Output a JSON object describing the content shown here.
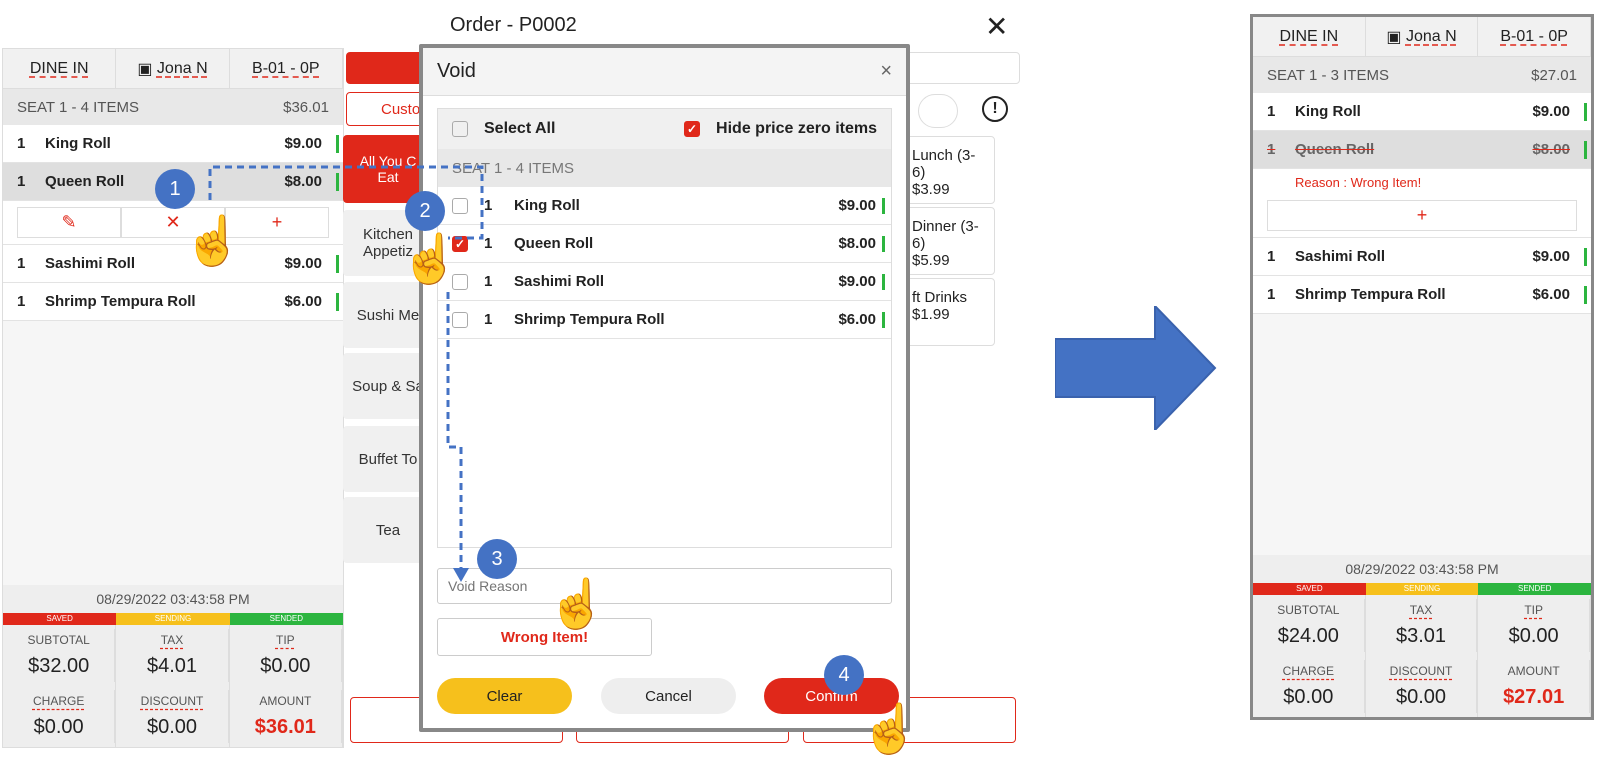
{
  "order_title": "Order - P0002",
  "header": {
    "type": "DINE IN",
    "server": "Jona N",
    "table": "B-01 -  0P"
  },
  "left": {
    "seat": "SEAT 1 - 4 ITEMS",
    "seat_total": "$36.01",
    "items": [
      {
        "qty": "1",
        "name": "King Roll",
        "price": "$9.00"
      },
      {
        "qty": "1",
        "name": "Queen Roll",
        "price": "$8.00"
      },
      {
        "qty": "1",
        "name": "Sashimi Roll",
        "price": "$9.00"
      },
      {
        "qty": "1",
        "name": "Shrimp Tempura Roll",
        "price": "$6.00"
      }
    ],
    "timestamp": "08/29/2022 03:43:58 PM",
    "status": [
      "SAVED",
      "SENDING",
      "SENDED"
    ],
    "subtotal_l": "SUBTOTAL",
    "subtotal": "$32.00",
    "tax_l": "TAX",
    "tax": "$4.01",
    "tip_l": "TIP",
    "tip": "$0.00",
    "charge_l": "CHARGE",
    "charge": "$0.00",
    "discount_l": "DISCOUNT",
    "discount": "$0.00",
    "amount_l": "AMOUNT",
    "amount": "$36.01"
  },
  "categories": [
    "All You Can Eat",
    "Kitchen Appetizer",
    "Sushi Menu",
    "Soup & Salad",
    "Buffet To",
    "Tea"
  ],
  "cat_partial": [
    "All You C\nEat",
    "Kitchen\nAppetiz",
    "Sushi Me",
    "Soup & Sa",
    "Buffet To",
    "Tea"
  ],
  "custom_label": "Custo",
  "menu_items": [
    {
      "name": "Lunch (3-6)",
      "price": "$3.99"
    },
    {
      "name": "Dinner (3-6)",
      "price": "$5.99"
    },
    {
      "name": "ft Drinks",
      "price": "$1.99"
    }
  ],
  "modal": {
    "title": "Void",
    "close": "×",
    "select_all": "Select All",
    "hide_zero": "Hide price zero items",
    "seat": "SEAT 1 - 4 ITEMS",
    "items": [
      {
        "qty": "1",
        "name": "King Roll",
        "price": "$9.00",
        "checked": false
      },
      {
        "qty": "1",
        "name": "Queen Roll",
        "price": "$8.00",
        "checked": true
      },
      {
        "qty": "1",
        "name": "Sashimi Roll",
        "price": "$9.00",
        "checked": false
      },
      {
        "qty": "1",
        "name": "Shrimp Tempura Roll",
        "price": "$6.00",
        "checked": false
      }
    ],
    "reason_placeholder": "Void Reason",
    "preset_reason": "Wrong Item!",
    "clear": "Clear",
    "cancel": "Cancel",
    "confirm": "Confirm"
  },
  "steps": [
    "1",
    "2",
    "3",
    "4"
  ],
  "right": {
    "seat": "SEAT 1 - 3 ITEMS",
    "seat_total": "$27.01",
    "items": [
      {
        "qty": "1",
        "name": "King Roll",
        "price": "$9.00"
      },
      {
        "qty": "1",
        "name": "Queen Roll",
        "price": "$8.00"
      },
      {
        "qty": "1",
        "name": "Sashimi Roll",
        "price": "$9.00"
      },
      {
        "qty": "1",
        "name": "Shrimp Tempura Roll",
        "price": "$6.00"
      }
    ],
    "reason": "Reason : Wrong Item!",
    "timestamp": "08/29/2022 03:43:58 PM",
    "subtotal": "$24.00",
    "tax": "$3.01",
    "tip": "$0.00",
    "charge": "$0.00",
    "discount": "$0.00",
    "amount": "$27.01"
  },
  "colors": {
    "accent": "#e0281a",
    "sent": "#2cb53f",
    "sending": "#f6c01c",
    "step": "#4472c4"
  }
}
